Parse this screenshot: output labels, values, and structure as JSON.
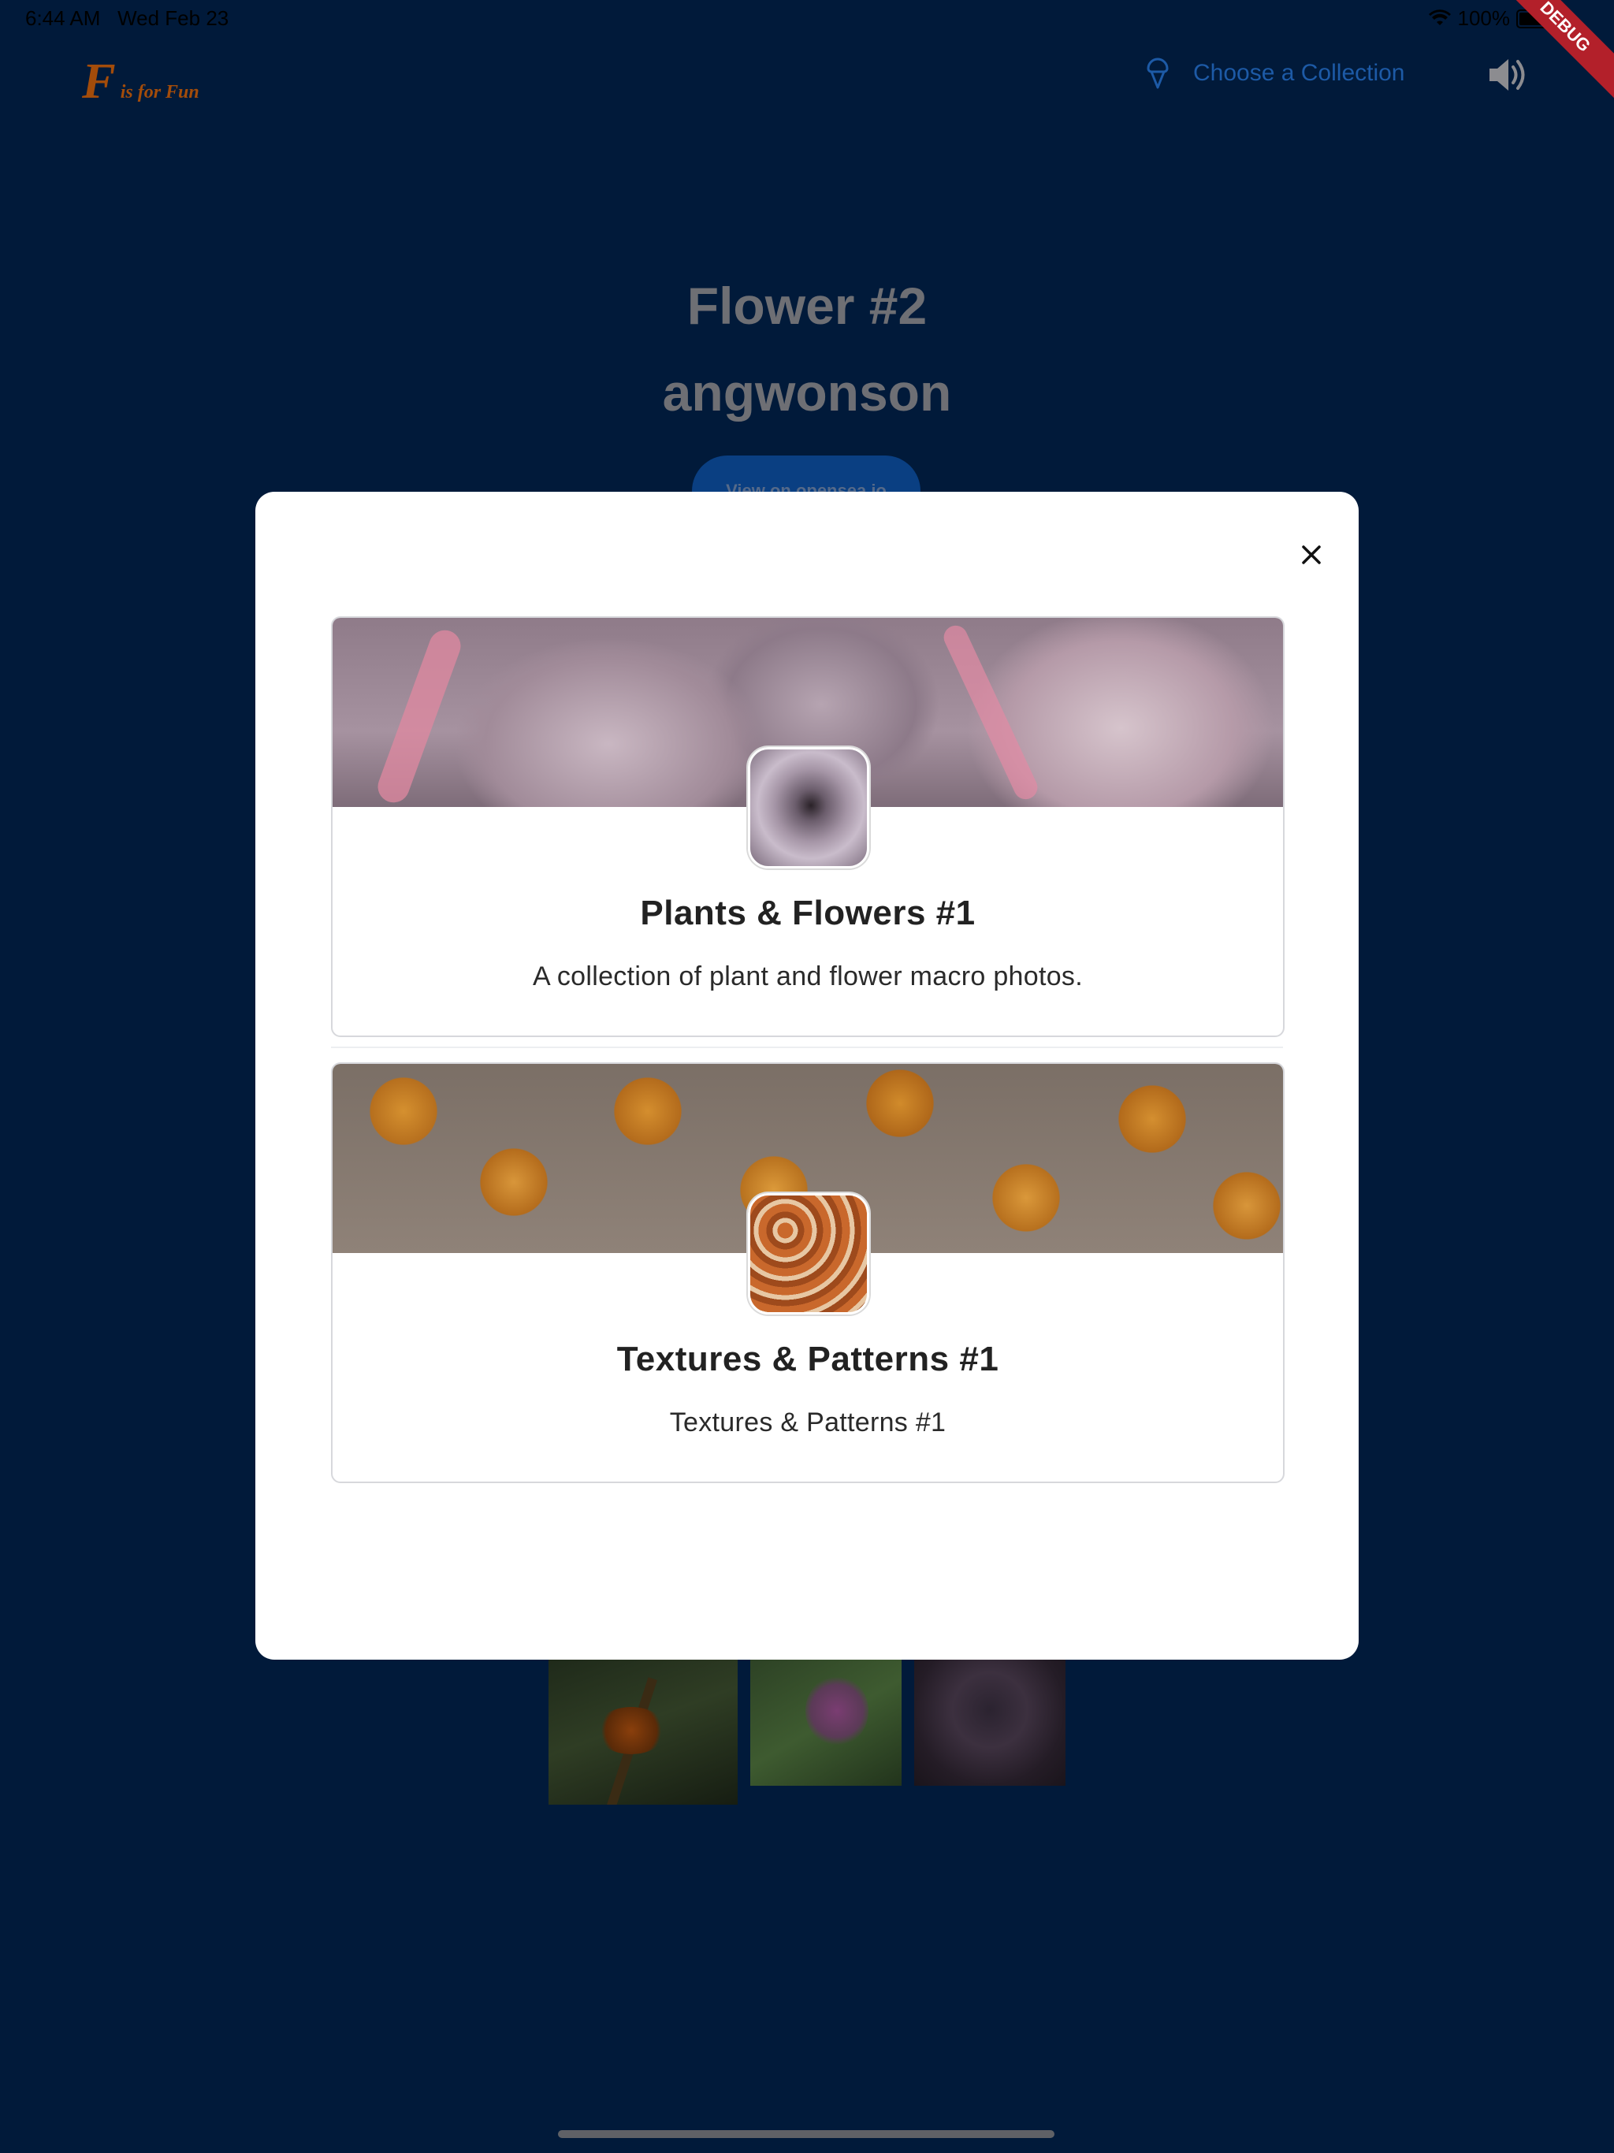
{
  "status_bar": {
    "time": "6:44 AM",
    "date": "Wed Feb 23",
    "battery": "100%",
    "wifi_icon": "wifi-icon"
  },
  "debug_ribbon": "DEBUG",
  "app_bar": {
    "logo_letter": "F",
    "logo_text": "is for Fun",
    "choose_collection_label": "Choose a Collection",
    "volume_icon": "volume-icon"
  },
  "page": {
    "title": "Flower #2",
    "username": "angwonson",
    "opensea_label": "View on opensea.io"
  },
  "dialog": {
    "collections": [
      {
        "title": "Plants & Flowers #1",
        "description": "A collection of plant and flower macro photos."
      },
      {
        "title": "Textures & Patterns #1",
        "description": "Textures & Patterns #1"
      }
    ]
  },
  "colors": {
    "background": "#011a3a",
    "accent": "#1d5aa6",
    "logo": "#a34c0a"
  }
}
